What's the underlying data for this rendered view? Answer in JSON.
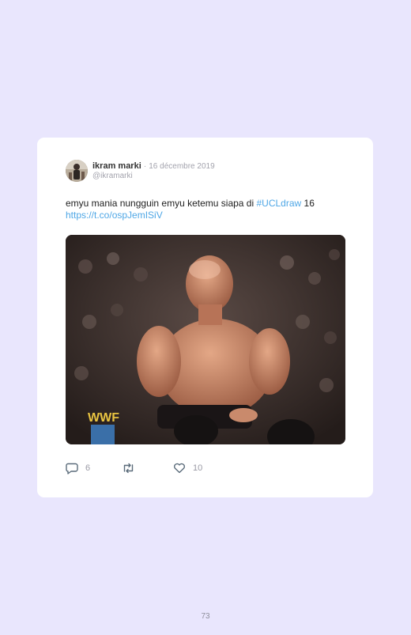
{
  "tweet": {
    "author_name": "ikram marki",
    "separator": "·",
    "date": "16 décembre 2019",
    "handle": "@ikramarki",
    "text_before": "emyu mania nungguin emyu ketemu siapa di ",
    "hashtag": "#UCLdraw",
    "text_after": " 16",
    "link": "https://t.co/ospJemISiV",
    "media_alt": "wrestler sitting on ring corner GIF",
    "media_watermark": "WWF",
    "actions": {
      "reply_count": "6",
      "retweet_count": "",
      "like_count": "10"
    },
    "icons": {
      "reply": "reply-icon",
      "retweet": "retweet-icon",
      "like": "heart-icon"
    },
    "colors": {
      "link": "#4fa7e6",
      "background": "#e9e6fd",
      "card": "#ffffff"
    }
  },
  "page": {
    "number": "73"
  }
}
